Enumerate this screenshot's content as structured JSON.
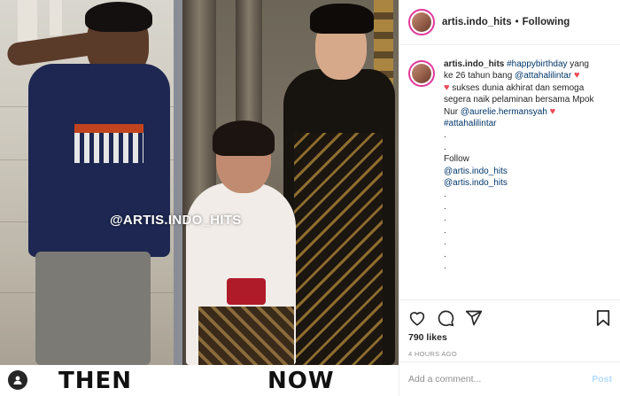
{
  "post": {
    "media": {
      "watermark": "@ARTIS.INDO_HITS",
      "then_label": "THEN",
      "now_label": "NOW",
      "user_tag_icon": "person-icon"
    },
    "header": {
      "username": "artis.indo_hits",
      "separator": "•",
      "follow_state": "Following"
    },
    "caption": {
      "username": "artis.indo_hits",
      "lines": [
        {
          "segments": [
            {
              "t": "#happybirthday",
              "tag": true
            },
            {
              "t": " yang"
            }
          ]
        },
        {
          "segments": [
            {
              "t": "ke 26 tahun bang "
            },
            {
              "t": "@attahalilintar",
              "tag": true
            },
            {
              "t": " "
            },
            {
              "t": "♥",
              "heart": true
            }
          ]
        },
        {
          "segments": [
            {
              "t": "♥",
              "heart": true
            },
            {
              "t": " sukses dunia akhirat dan semoga"
            }
          ]
        },
        {
          "segments": [
            {
              "t": "segera naik pelaminan bersama Mpok"
            }
          ]
        },
        {
          "segments": [
            {
              "t": "Nur "
            },
            {
              "t": "@aurelie.hermansyah",
              "tag": true
            },
            {
              "t": " "
            },
            {
              "t": "♥",
              "heart": true
            }
          ]
        },
        {
          "segments": [
            {
              "t": "#attahalilintar",
              "tag": true
            }
          ]
        },
        {
          "segments": [
            {
              "t": "."
            }
          ]
        },
        {
          "segments": [
            {
              "t": "."
            }
          ]
        },
        {
          "segments": [
            {
              "t": "Follow"
            }
          ]
        },
        {
          "segments": [
            {
              "t": "@artis.indo_hits",
              "tag": true
            }
          ]
        },
        {
          "segments": [
            {
              "t": "@artis.indo_hits",
              "tag": true
            }
          ]
        },
        {
          "segments": [
            {
              "t": "."
            }
          ]
        },
        {
          "segments": [
            {
              "t": "."
            }
          ]
        },
        {
          "segments": [
            {
              "t": "."
            }
          ]
        },
        {
          "segments": [
            {
              "t": "."
            }
          ]
        },
        {
          "segments": [
            {
              "t": "."
            }
          ]
        },
        {
          "segments": [
            {
              "t": "."
            }
          ]
        },
        {
          "segments": [
            {
              "t": "."
            }
          ]
        }
      ]
    },
    "actions": {
      "like_icon": "heart-icon",
      "comment_icon": "comment-icon",
      "share_icon": "share-icon",
      "save_icon": "bookmark-icon"
    },
    "likes": "790 likes",
    "time": "4 HOURS AGO",
    "comment": {
      "placeholder": "Add a comment...",
      "post_label": "Post"
    },
    "colors": {
      "link": "#00376b",
      "heart": "#ed4956",
      "story_ring": "#e0389a",
      "post_disabled": "#b3dbff"
    }
  }
}
